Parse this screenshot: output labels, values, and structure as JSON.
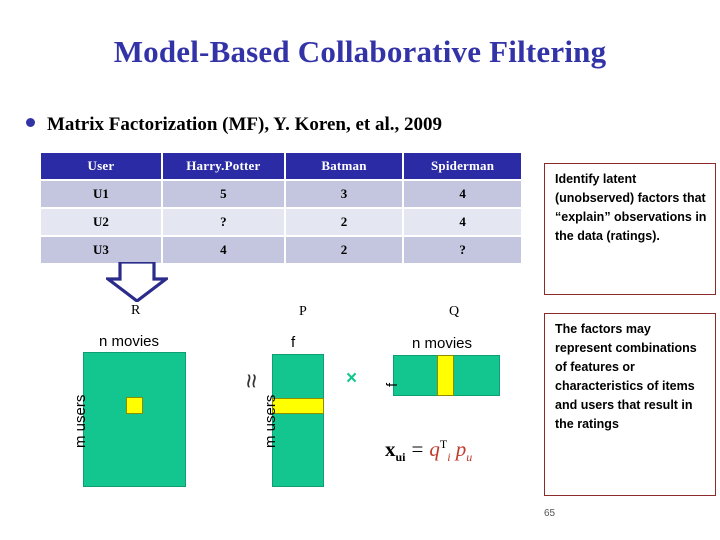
{
  "slide": {
    "title": "Model-Based Collaborative Filtering",
    "page_number": "65",
    "bullet": {
      "icon": "bullet-dot",
      "text": "Matrix Factorization (MF), Y. Koren, et al., 2009"
    }
  },
  "ratings_table": {
    "headers": [
      "User",
      "Harry.Potter",
      "Batman",
      "Spiderman"
    ],
    "rows": [
      {
        "user": "U1",
        "harry_potter": "5",
        "batman": "3",
        "spiderman": "4"
      },
      {
        "user": "U2",
        "harry_potter": "?",
        "batman": "2",
        "spiderman": "4"
      },
      {
        "user": "U3",
        "harry_potter": "4",
        "batman": "2",
        "spiderman": "?"
      }
    ]
  },
  "diagram": {
    "arrow_label": "R",
    "approx_symbol": "≈",
    "times_symbol": "×",
    "matrices": [
      {
        "name": "R",
        "top_label": "n movies",
        "side_label": "m users"
      },
      {
        "name": "P",
        "top_label": "f",
        "side_label": "m users"
      },
      {
        "name": "Q",
        "top_label": "n movies",
        "side_label": "f"
      }
    ],
    "equation": {
      "lhs_base": "x",
      "lhs_sub": "ui",
      "equals": "=",
      "q_base": "q",
      "q_sup": "T",
      "q_sub": "i",
      "p_base": "p",
      "p_sub": "u"
    }
  },
  "notes": [
    {
      "id": "note-identify-latent-factors",
      "text": "Identify latent (unobserved) factors that “explain” observations in the data (ratings)."
    },
    {
      "id": "note-factors-represent",
      "text": "The factors may represent combinations of features or characteristics of items and users that result in the ratings"
    }
  ],
  "colors": {
    "title_blue": "#3333A8",
    "table_header_blue": "#2B2BA5",
    "row_dark": "#C3C6DE",
    "row_light": "#E4E6F2",
    "matrix_green": "#13C68F",
    "highlight_yellow": "#FFFF00",
    "note_border_red": "#8C2B2B",
    "equation_red": "#C0392B"
  }
}
